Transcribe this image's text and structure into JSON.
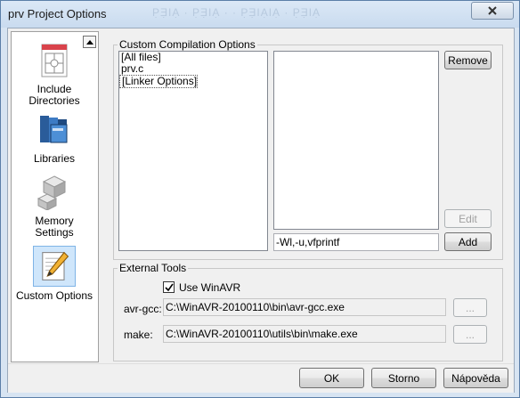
{
  "window": {
    "title": "prv Project Options",
    "ghost_title": "Ρ̣Ǝ̣ΙΑ̣ ·  Ρ̣Ǝ̣ΙΑ̣ ·  ·  Ρ̣Ǝ̣ΙΑ̣ΙΑ̣ ·  Ρ̣Ǝ̣ΙΑ̣"
  },
  "sidebar": {
    "items": [
      {
        "label": "Include Directories",
        "icon": "include-directories-icon"
      },
      {
        "label": "Libraries",
        "icon": "libraries-icon"
      },
      {
        "label": "Memory Settings",
        "icon": "memory-settings-icon"
      },
      {
        "label": "Custom Options",
        "icon": "custom-options-icon",
        "selected": true
      }
    ]
  },
  "custom_compilation": {
    "legend": "Custom Compilation Options",
    "files": [
      "[All files]",
      "prv.c",
      "[Linker Options]"
    ],
    "selected_index": 2,
    "remove_label": "Remove",
    "edit_label": "Edit",
    "add_label": "Add",
    "option_value": "-Wl,-u,vfprintf"
  },
  "external_tools": {
    "legend": "External Tools",
    "use_winavr_label": "Use WinAVR",
    "use_winavr_checked": true,
    "avr_gcc_label": "avr-gcc:",
    "avr_gcc_path": "C:\\WinAVR-20100110\\bin\\avr-gcc.exe",
    "make_label": "make:",
    "make_path": "C:\\WinAVR-20100110\\utils\\bin\\make.exe",
    "browse_label": "..."
  },
  "buttons": {
    "ok": "OK",
    "cancel": "Storno",
    "help": "Nápověda"
  },
  "colors": {
    "titlebar": "#c9dbef",
    "selection": "#cfe6fb"
  }
}
